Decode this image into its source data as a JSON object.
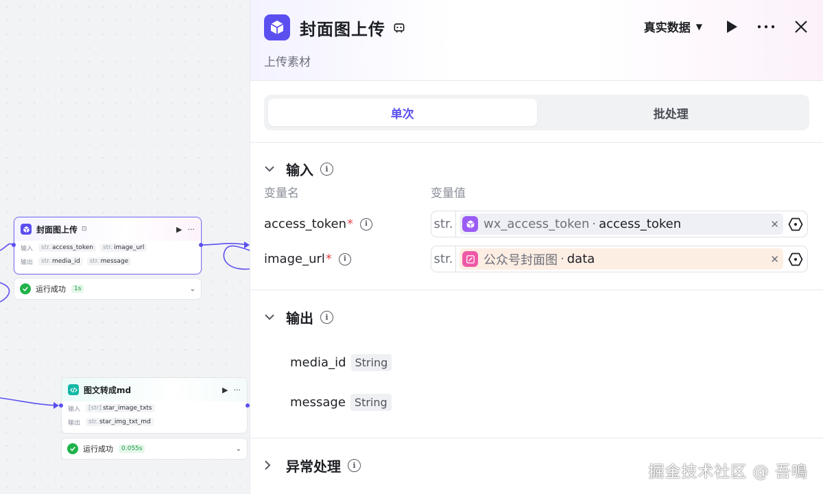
{
  "canvas": {
    "node1": {
      "title": "封面图上传",
      "in_label": "输入",
      "out_label": "输出",
      "inputs": [
        {
          "type": "str.",
          "name": "access_token"
        },
        {
          "type": "str.",
          "name": "image_url"
        }
      ],
      "outputs": [
        {
          "type": "str.",
          "name": "media_id"
        },
        {
          "type": "str.",
          "name": "message"
        }
      ],
      "status": "运行成功",
      "time": "1s"
    },
    "node2": {
      "title": "图文转成md",
      "in_label": "输入",
      "out_label": "输出",
      "inputs": [
        {
          "type": "[str]",
          "name": "star_image_txts"
        }
      ],
      "outputs": [
        {
          "type": "str.",
          "name": "star_img_txt_md"
        }
      ],
      "status": "运行成功",
      "time": "0.055s"
    }
  },
  "panel": {
    "title": "封面图上传",
    "subtitle": "上传素材",
    "mode": "真实数据",
    "tabs": [
      {
        "label": "单次"
      },
      {
        "label": "批处理"
      }
    ],
    "input_section": {
      "title": "输入",
      "col_name": "变量名",
      "col_value": "变量值",
      "vars": [
        {
          "name": "access_token",
          "required": "*",
          "type": "str.",
          "ref_node": "wx_access_token",
          "sep": "·",
          "ref_var": "access_token"
        },
        {
          "name": "image_url",
          "required": "*",
          "type": "str.",
          "ref_node": "公众号封面图",
          "sep": "·",
          "ref_var": "data"
        }
      ]
    },
    "output_section": {
      "title": "输出",
      "outputs": [
        {
          "name": "media_id",
          "type": "String"
        },
        {
          "name": "message",
          "type": "String"
        }
      ]
    },
    "exception_section": {
      "title": "异常处理"
    }
  },
  "watermark": "掘金技术社区 @ 吾鳴",
  "colors": {
    "accent": "#5b4ff0",
    "success": "#1fb24a",
    "required": "#e5484d"
  }
}
